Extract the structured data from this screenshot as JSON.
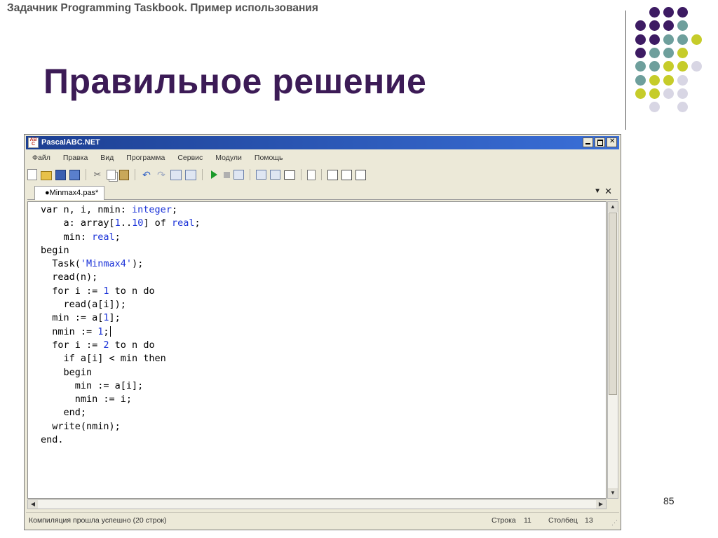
{
  "slide": {
    "subtitle": "Задачник Programming Taskbook. Пример использования",
    "title": "Правильное решение",
    "page_number": "85",
    "colors": {
      "title": "#3c1b56",
      "purple": "#3d1b63",
      "teal": "#6e9f9c",
      "yellow": "#c6cc2a",
      "lavender": "#d8d6e4"
    }
  },
  "window": {
    "title": "PascalABC.NET",
    "menu": [
      "Файл",
      "Правка",
      "Вид",
      "Программа",
      "Сервис",
      "Модули",
      "Помощь"
    ],
    "toolbar_icons": [
      "new-file-icon",
      "open-folder-icon",
      "save-icon",
      "save-all-icon",
      "cut-icon",
      "copy-icon",
      "paste-icon",
      "undo-icon",
      "redo-icon",
      "generate-code-icon",
      "format-icon",
      "run-icon",
      "stop-icon",
      "debug-icon",
      "output-window-icon",
      "terminal-icon",
      "document-icon",
      "task-icon",
      "task-demo-icon",
      "task-results-icon"
    ],
    "tab_label": "●Minmax4.pas*",
    "code_lines": [
      "var n, i, nmin: integer;",
      "    a: array[1..10] of real;",
      "    min: real;",
      "begin",
      "  Task('Minmax4');",
      "  read(n);",
      "  for i := 1 to n do",
      "    read(a[i]);",
      "  min := a[1];",
      "  nmin := 1;",
      "  for i := 2 to n do",
      "    if a[i] < min then",
      "    begin",
      "      min := a[i];",
      "      nmin := i;",
      "    end;",
      "  write(nmin);",
      "end."
    ],
    "status": {
      "message": "Компиляция прошла успешно (20 строк)",
      "line_label": "Строка",
      "line_value": "11",
      "column_label": "Столбец",
      "column_value": "13"
    }
  }
}
